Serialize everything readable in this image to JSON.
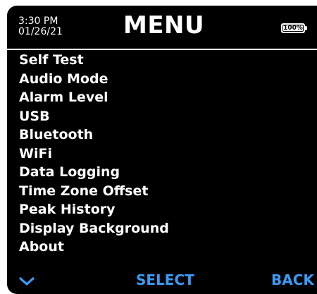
{
  "header": {
    "time": "3:30 PM",
    "date": "01/26/21",
    "title": "MENU",
    "battery": "100%"
  },
  "menu": {
    "items": [
      {
        "label": "Self Test"
      },
      {
        "label": "Audio Mode"
      },
      {
        "label": "Alarm Level"
      },
      {
        "label": "USB"
      },
      {
        "label": "Bluetooth"
      },
      {
        "label": "WiFi"
      },
      {
        "label": "Data Logging"
      },
      {
        "label": "Time Zone Offset"
      },
      {
        "label": "Peak History"
      },
      {
        "label": "Display Background"
      },
      {
        "label": "About"
      }
    ]
  },
  "softkeys": {
    "left_icon": "chevron-down-icon",
    "center": "SELECT",
    "right": "BACK"
  },
  "colors": {
    "background": "#000000",
    "text": "#ffffff",
    "softkey": "#3b9bf5"
  }
}
